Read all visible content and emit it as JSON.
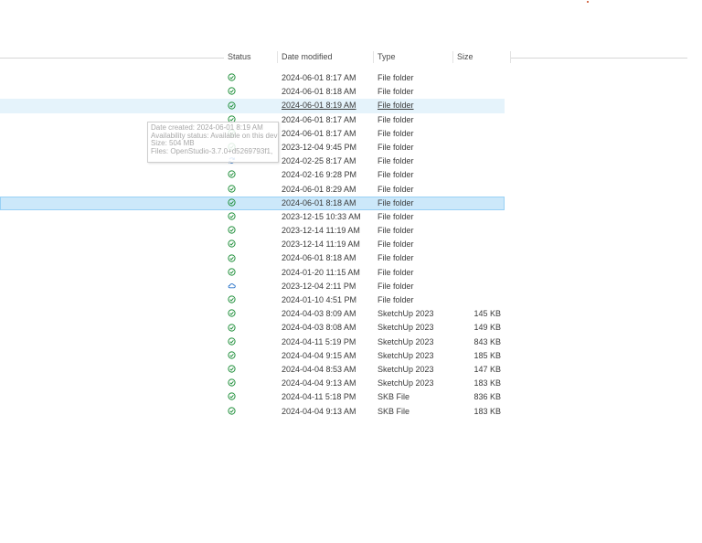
{
  "columns": {
    "status": "Status",
    "date": "Date modified",
    "type": "Type",
    "size": "Size"
  },
  "tooltip": {
    "created": "Date created: 2024-06-01 8:19 AM",
    "availability": "Availability status: Available on this device",
    "size": "Size: 504 MB",
    "files": "Files: OpenStudio-3.7.0+d5269793f1,"
  },
  "rows": [
    {
      "status": "synced",
      "date": "2024-06-01 8:17 AM",
      "type": "File folder",
      "size": ""
    },
    {
      "status": "synced",
      "date": "2024-06-01 8:18 AM",
      "type": "File folder",
      "size": ""
    },
    {
      "status": "synced",
      "date": "2024-06-01 8:19 AM",
      "type": "File folder",
      "size": ""
    },
    {
      "status": "synced",
      "date": "2024-06-01 8:17 AM",
      "type": "File folder",
      "size": ""
    },
    {
      "status": "synced",
      "date": "2024-06-01 8:17 AM",
      "type": "File folder",
      "size": ""
    },
    {
      "status": "synced",
      "date": "2023-12-04 9:45 PM",
      "type": "File folder",
      "size": ""
    },
    {
      "status": "syncing",
      "date": "2024-02-25 8:17 AM",
      "type": "File folder",
      "size": ""
    },
    {
      "status": "synced",
      "date": "2024-02-16 9:28 PM",
      "type": "File folder",
      "size": ""
    },
    {
      "status": "synced",
      "date": "2024-06-01 8:29 AM",
      "type": "File folder",
      "size": ""
    },
    {
      "status": "synced",
      "date": "2024-06-01 8:18 AM",
      "type": "File folder",
      "size": ""
    },
    {
      "status": "synced",
      "date": "2023-12-15 10:33 AM",
      "type": "File folder",
      "size": ""
    },
    {
      "status": "synced",
      "date": "2023-12-14 11:19 AM",
      "type": "File folder",
      "size": ""
    },
    {
      "status": "synced",
      "date": "2023-12-14 11:19 AM",
      "type": "File folder",
      "size": ""
    },
    {
      "status": "synced",
      "date": "2024-06-01 8:18 AM",
      "type": "File folder",
      "size": ""
    },
    {
      "status": "synced",
      "date": "2024-01-20 11:15 AM",
      "type": "File folder",
      "size": ""
    },
    {
      "status": "cloud",
      "date": "2023-12-04 2:11 PM",
      "type": "File folder",
      "size": ""
    },
    {
      "status": "synced",
      "date": "2024-01-10 4:51 PM",
      "type": "File folder",
      "size": ""
    },
    {
      "status": "synced",
      "date": "2024-04-03 8:09 AM",
      "type": "SketchUp 2023",
      "size": "145 KB"
    },
    {
      "status": "synced",
      "date": "2024-04-03 8:08 AM",
      "type": "SketchUp 2023",
      "size": "149 KB"
    },
    {
      "status": "synced",
      "date": "2024-04-11 5:19 PM",
      "type": "SketchUp 2023",
      "size": "843 KB"
    },
    {
      "status": "synced",
      "date": "2024-04-04 9:15 AM",
      "type": "SketchUp 2023",
      "size": "185 KB"
    },
    {
      "status": "synced",
      "date": "2024-04-04 8:53 AM",
      "type": "SketchUp 2023",
      "size": "147 KB"
    },
    {
      "status": "synced",
      "date": "2024-04-04 9:13 AM",
      "type": "SketchUp 2023",
      "size": "183 KB"
    },
    {
      "status": "synced",
      "date": "2024-04-11 5:18 PM",
      "type": "SKB File",
      "size": "836 KB"
    },
    {
      "status": "synced",
      "date": "2024-04-04 9:13 AM",
      "type": "SKB File",
      "size": "183 KB"
    }
  ],
  "hover_row": 2,
  "selected_row": 9,
  "colors": {
    "synced": "#1f8f3a",
    "syncing": "#2b74c9",
    "cloud": "#2b74c9",
    "selection": "#cce8fa",
    "hover": "#e5f3fb"
  }
}
